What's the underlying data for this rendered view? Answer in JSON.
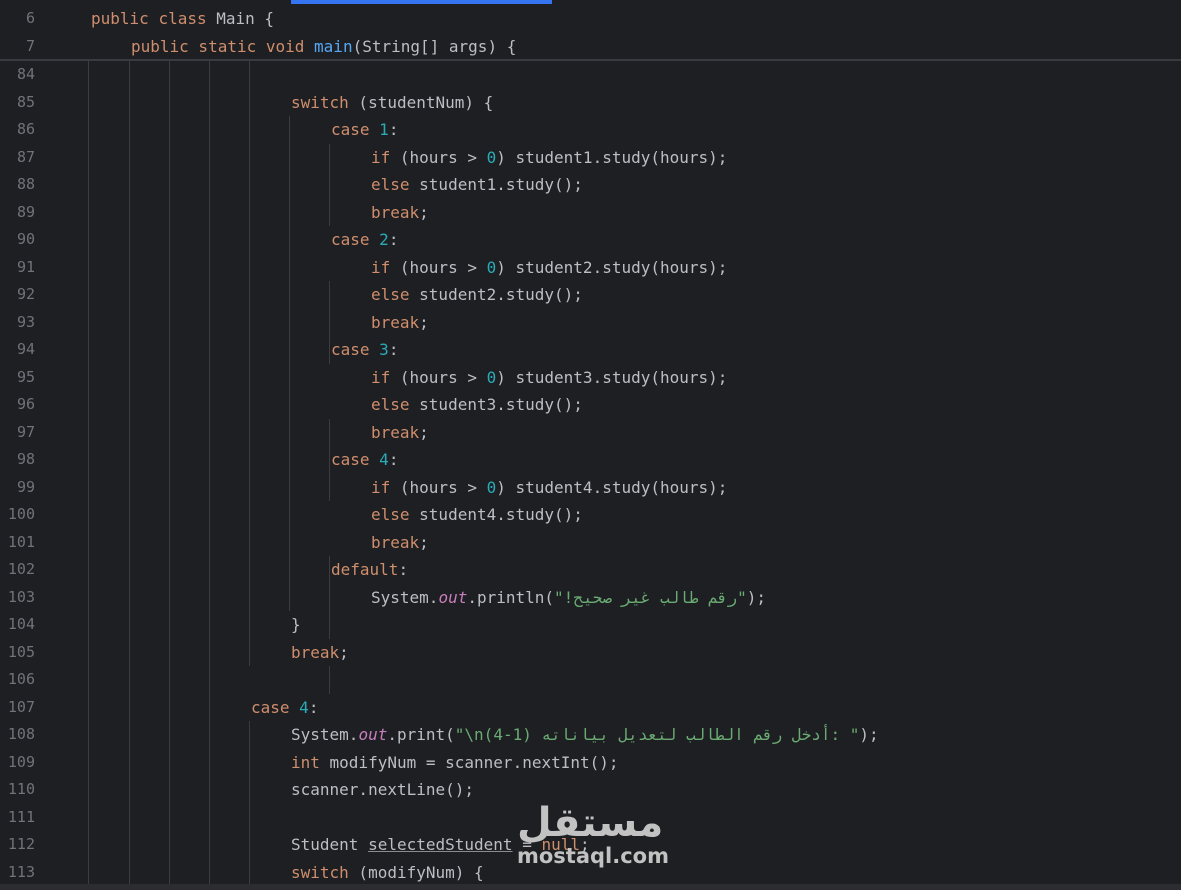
{
  "colors": {
    "background": "#1e1f22",
    "keyword": "#cf8e6d",
    "number": "#2aacb8",
    "method_declaration": "#56a8f5",
    "string": "#6aab73",
    "static_field": "#c77dbb",
    "line_number": "#6f737a",
    "tab_indicator": "#3574f0"
  },
  "sticky_lines": [
    {
      "num": "6",
      "indent": 1,
      "tokens": [
        [
          "kw",
          "public"
        ],
        [
          "",
          "&#32;"
        ],
        [
          "kw",
          "class"
        ],
        [
          "",
          " Main {"
        ]
      ]
    },
    {
      "num": "7",
      "indent": 2,
      "tokens": [
        [
          "kw",
          "public"
        ],
        [
          "",
          ""
        ],
        [
          "kw",
          " static"
        ],
        [
          "kw",
          " void"
        ],
        [
          "fn",
          " main"
        ],
        [
          "",
          "(String[] args) {"
        ]
      ]
    }
  ],
  "lines": [
    {
      "num": "84",
      "indent": 0,
      "tokens": []
    },
    {
      "num": "85",
      "indent": 6,
      "tokens": [
        [
          "kw",
          "switch"
        ],
        [
          "",
          " (studentNum) {"
        ]
      ]
    },
    {
      "num": "86",
      "indent": 7,
      "tokens": [
        [
          "kw",
          "case"
        ],
        [
          "",
          " "
        ],
        [
          "num",
          "1"
        ],
        [
          "",
          ":"
        ]
      ]
    },
    {
      "num": "87",
      "indent": 8,
      "tokens": [
        [
          "kw",
          "if"
        ],
        [
          "",
          " (hours > "
        ],
        [
          "num",
          "0"
        ],
        [
          "",
          ") student1.study(hours);"
        ]
      ]
    },
    {
      "num": "88",
      "indent": 8,
      "tokens": [
        [
          "kw",
          "else"
        ],
        [
          "",
          " student1.study();"
        ]
      ]
    },
    {
      "num": "89",
      "indent": 8,
      "tokens": [
        [
          "kw",
          "break"
        ],
        [
          "",
          ";"
        ]
      ]
    },
    {
      "num": "90",
      "indent": 7,
      "tokens": [
        [
          "kw",
          "case"
        ],
        [
          "",
          " "
        ],
        [
          "num",
          "2"
        ],
        [
          "",
          ":"
        ]
      ]
    },
    {
      "num": "91",
      "indent": 8,
      "tokens": [
        [
          "kw",
          "if"
        ],
        [
          "",
          " (hours > "
        ],
        [
          "num",
          "0"
        ],
        [
          "",
          ") student2.study(hours);"
        ]
      ]
    },
    {
      "num": "92",
      "indent": 8,
      "tokens": [
        [
          "kw",
          "else"
        ],
        [
          "",
          " student2.study();"
        ]
      ]
    },
    {
      "num": "93",
      "indent": 8,
      "tokens": [
        [
          "kw",
          "break"
        ],
        [
          "",
          ";"
        ]
      ]
    },
    {
      "num": "94",
      "indent": 7,
      "tokens": [
        [
          "kw",
          "case"
        ],
        [
          "",
          " "
        ],
        [
          "num",
          "3"
        ],
        [
          "",
          ":"
        ]
      ]
    },
    {
      "num": "95",
      "indent": 8,
      "tokens": [
        [
          "kw",
          "if"
        ],
        [
          "",
          " (hours > "
        ],
        [
          "num",
          "0"
        ],
        [
          "",
          ") student3.study(hours);"
        ]
      ]
    },
    {
      "num": "96",
      "indent": 8,
      "tokens": [
        [
          "kw",
          "else"
        ],
        [
          "",
          " student3.study();"
        ]
      ]
    },
    {
      "num": "97",
      "indent": 8,
      "tokens": [
        [
          "kw",
          "break"
        ],
        [
          "",
          ";"
        ]
      ]
    },
    {
      "num": "98",
      "indent": 7,
      "tokens": [
        [
          "kw",
          "case"
        ],
        [
          "",
          " "
        ],
        [
          "num",
          "4"
        ],
        [
          "",
          ":"
        ]
      ]
    },
    {
      "num": "99",
      "indent": 8,
      "tokens": [
        [
          "kw",
          "if"
        ],
        [
          "",
          " (hours > "
        ],
        [
          "num",
          "0"
        ],
        [
          "",
          ") student4.study(hours);"
        ]
      ]
    },
    {
      "num": "100",
      "indent": 8,
      "tokens": [
        [
          "kw",
          "else"
        ],
        [
          "",
          " student4.study();"
        ]
      ]
    },
    {
      "num": "101",
      "indent": 8,
      "tokens": [
        [
          "kw",
          "break"
        ],
        [
          "",
          ";"
        ]
      ]
    },
    {
      "num": "102",
      "indent": 7,
      "tokens": [
        [
          "kw",
          "default"
        ],
        [
          "",
          ":"
        ]
      ]
    },
    {
      "num": "103",
      "indent": 8,
      "tokens": [
        [
          "",
          "System."
        ],
        [
          "fld",
          "out"
        ],
        [
          "",
          ".println("
        ],
        [
          "str",
          "\"رقم طالب غير صحيح!\""
        ],
        [
          "",
          ");"
        ]
      ]
    },
    {
      "num": "104",
      "indent": 6,
      "tokens": [
        [
          "",
          "}"
        ]
      ]
    },
    {
      "num": "105",
      "indent": 6,
      "tokens": [
        [
          "kw",
          "break"
        ],
        [
          "",
          ";"
        ]
      ]
    },
    {
      "num": "106",
      "indent": 0,
      "tokens": []
    },
    {
      "num": "107",
      "indent": 5,
      "tokens": [
        [
          "kw",
          "case"
        ],
        [
          "",
          " "
        ],
        [
          "num",
          "4"
        ],
        [
          "",
          ":"
        ]
      ]
    },
    {
      "num": "108",
      "indent": 6,
      "tokens": [
        [
          "",
          "System."
        ],
        [
          "fld",
          "out"
        ],
        [
          "",
          ".print("
        ],
        [
          "str",
          "\"\\n(4-1) أدخل رقم الطالب لتعديل بياناته: \""
        ],
        [
          "",
          ");"
        ]
      ]
    },
    {
      "num": "109",
      "indent": 6,
      "tokens": [
        [
          "kw",
          "int"
        ],
        [
          "",
          " modifyNum = scanner.nextInt();"
        ]
      ]
    },
    {
      "num": "110",
      "indent": 6,
      "tokens": [
        [
          "",
          "scanner.nextLine();"
        ]
      ]
    },
    {
      "num": "111",
      "indent": 0,
      "tokens": []
    },
    {
      "num": "112",
      "indent": 6,
      "tokens": [
        [
          "",
          "Student "
        ],
        [
          "ul",
          "selectedStudent"
        ],
        [
          "",
          " = "
        ],
        [
          "kw",
          "null"
        ],
        [
          "",
          ";"
        ]
      ]
    },
    {
      "num": "113",
      "indent": 6,
      "tokens": [
        [
          "kw",
          "switch"
        ],
        [
          "",
          " (modifyNum) {"
        ]
      ]
    }
  ],
  "watermark": {
    "logo": "مستقل",
    "url": "mostaql.com"
  }
}
